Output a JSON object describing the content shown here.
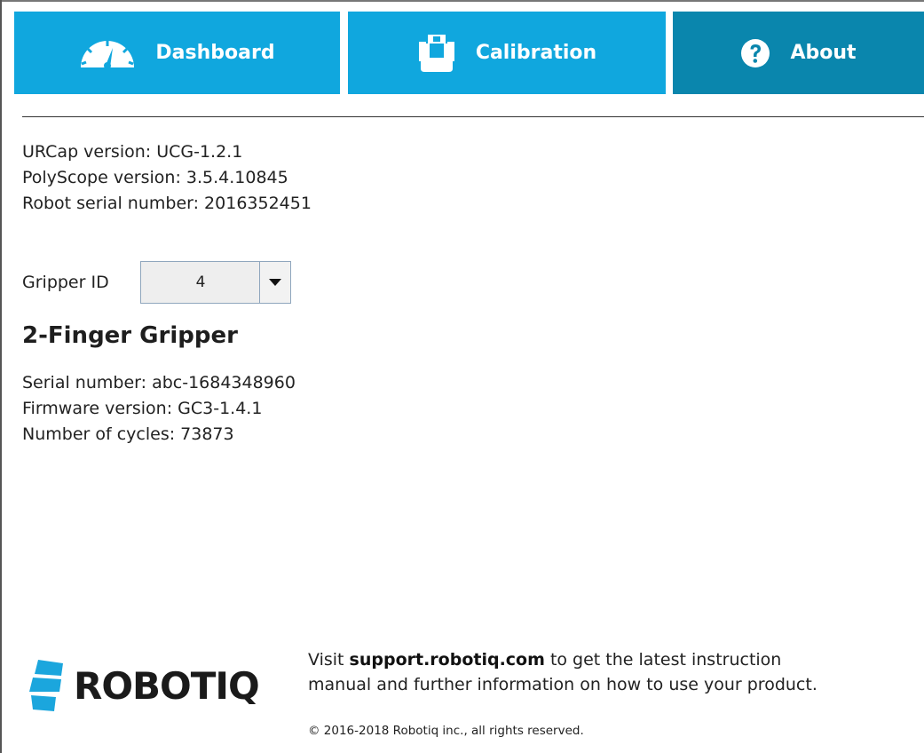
{
  "tabs": {
    "dashboard": {
      "label": "Dashboard",
      "icon": "gauge-icon"
    },
    "calibration": {
      "label": "Calibration",
      "icon": "gripper-icon"
    },
    "about": {
      "label": "About",
      "icon": "question-icon",
      "active": true
    }
  },
  "colors": {
    "tab_blue": "#10a7de",
    "tab_active": "#0a86ad"
  },
  "info": {
    "urcap_version": "URCap version: UCG-1.2.1",
    "polyscope_version": "PolyScope version: 3.5.4.10845",
    "robot_serial": "Robot serial number: 2016352451"
  },
  "gripper_id": {
    "label": "Gripper ID",
    "value": "4"
  },
  "gripper": {
    "title": "2-Finger Gripper",
    "serial_number": "Serial number: abc-1684348960",
    "firmware_version": "Firmware version: GC3-1.4.1",
    "cycles": "Number of cycles: 73873"
  },
  "footer": {
    "logo_text": "ROBOTIQ",
    "support_prefix": "Visit ",
    "support_link": "support.robotiq.com",
    "support_suffix": " to get the latest instruction",
    "support_line2": "manual and further information on how to use your product.",
    "copyright": "© 2016-2018 Robotiq inc., all rights reserved."
  }
}
